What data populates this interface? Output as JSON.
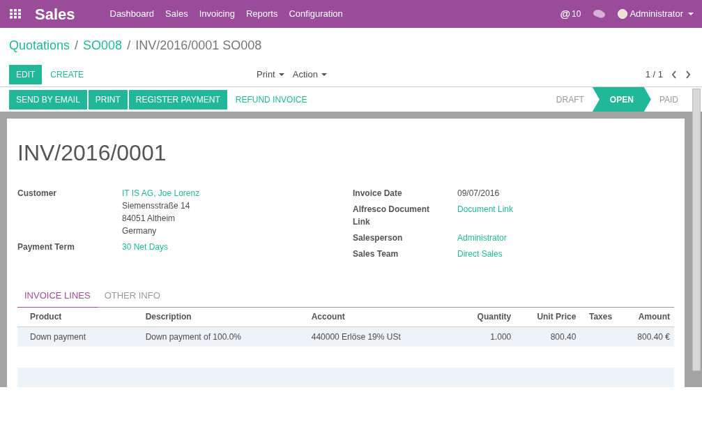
{
  "topbar": {
    "app_title": "Sales",
    "menu": [
      "Dashboard",
      "Sales",
      "Invoicing",
      "Reports",
      "Configuration"
    ],
    "mention_icon": "@",
    "mentions": "10",
    "user": "Administrator"
  },
  "breadcrumb": {
    "links": [
      "Quotations",
      "SO008"
    ],
    "separator": "/",
    "current": "INV/2016/0001 SO008"
  },
  "control_panel": {
    "buttons": [
      {
        "label": "EDIT",
        "kind": "primary"
      },
      {
        "label": "CREATE",
        "kind": "link"
      }
    ],
    "dropdowns": [
      "Print",
      "Action"
    ],
    "pager": "1 / 1"
  },
  "header": {
    "buttons": [
      {
        "label": "SEND BY EMAIL",
        "kind": "primary"
      },
      {
        "label": "PRINT",
        "kind": "primary"
      },
      {
        "label": "REGISTER PAYMENT",
        "kind": "primary"
      },
      {
        "label": "REFUND INVOICE",
        "kind": "link"
      }
    ],
    "stages": [
      {
        "label": "DRAFT",
        "selected": false
      },
      {
        "label": "OPEN",
        "selected": true
      },
      {
        "label": "PAID",
        "selected": false
      }
    ]
  },
  "sheet": {
    "title": "INV/2016/0001",
    "left_fields": [
      {
        "label": "Customer",
        "values": [
          "IT IS AG, Joe Lorenz",
          "Siemensstraße 14",
          "84051 Altheim",
          "Germany"
        ],
        "link_first": true
      },
      {
        "label": "Payment Term",
        "values": [
          "30 Net Days"
        ],
        "link_first": true
      }
    ],
    "right_fields": [
      {
        "label": "Invoice Date",
        "values": [
          "09/07/2016"
        ],
        "link_first": false
      },
      {
        "label": "Alfresco Document Link",
        "values": [
          "Document Link"
        ],
        "link_first": true
      },
      {
        "label": "Salesperson",
        "values": [
          "Administrator"
        ],
        "link_first": true
      },
      {
        "label": "Sales Team",
        "values": [
          "Direct Sales"
        ],
        "link_first": true
      }
    ],
    "tabs": [
      {
        "label": "INVOICE LINES",
        "selected": true
      },
      {
        "label": "OTHER INFO",
        "selected": false
      }
    ],
    "table": {
      "columns": [
        "Product",
        "Description",
        "Account",
        "Quantity",
        "Unit Price",
        "Taxes",
        "Amount"
      ],
      "rows": [
        [
          "Down payment",
          "Down payment of 100.0%",
          "440000 Erlöse 19% USt",
          "1.000",
          "800.40",
          "",
          "800.40 €"
        ]
      ]
    }
  }
}
